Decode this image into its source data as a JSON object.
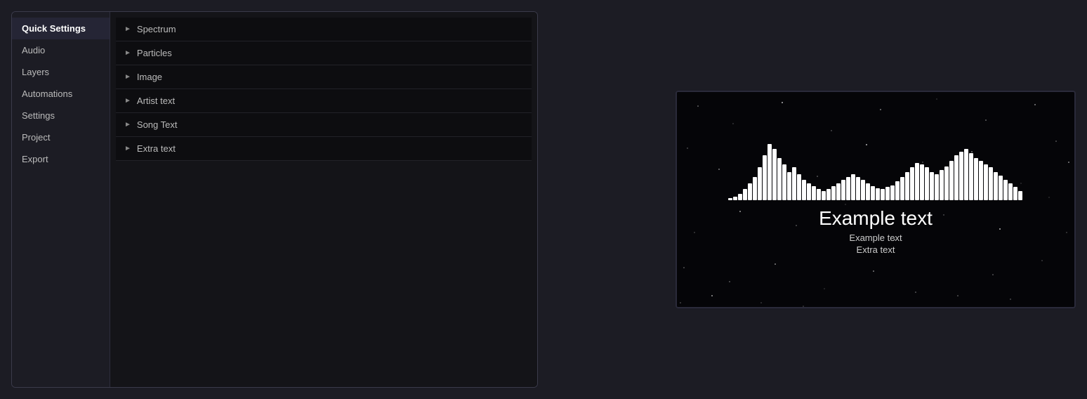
{
  "app": {
    "background_color": "#1c1c24"
  },
  "sidebar": {
    "items": [
      {
        "id": "quick-settings",
        "label": "Quick Settings",
        "active": true
      },
      {
        "id": "audio",
        "label": "Audio",
        "active": false
      },
      {
        "id": "layers",
        "label": "Layers",
        "active": false
      },
      {
        "id": "automations",
        "label": "Automations",
        "active": false
      },
      {
        "id": "settings",
        "label": "Settings",
        "active": false
      },
      {
        "id": "project",
        "label": "Project",
        "active": false
      },
      {
        "id": "export",
        "label": "Export",
        "active": false
      }
    ]
  },
  "layers": {
    "items": [
      {
        "id": "spectrum",
        "label": "Spectrum"
      },
      {
        "id": "particles",
        "label": "Particles"
      },
      {
        "id": "image",
        "label": "Image"
      },
      {
        "id": "artist-text",
        "label": "Artist text"
      },
      {
        "id": "song-text",
        "label": "Song Text"
      },
      {
        "id": "extra-text",
        "label": "Extra text"
      }
    ]
  },
  "preview": {
    "main_text": "Example text",
    "sub_text": "Example text",
    "extra_text": "Extra text"
  },
  "spectrum_bars": [
    2,
    4,
    7,
    12,
    18,
    25,
    35,
    48,
    60,
    55,
    45,
    38,
    30,
    35,
    28,
    22,
    18,
    15,
    12,
    10,
    12,
    15,
    18,
    22,
    25,
    28,
    25,
    22,
    18,
    15,
    13,
    12,
    14,
    16,
    20,
    25,
    30,
    35,
    40,
    38,
    35,
    30,
    28,
    32,
    36,
    42,
    48,
    52,
    55,
    50,
    45,
    42,
    38,
    35,
    30,
    26,
    22,
    18,
    14,
    10
  ]
}
